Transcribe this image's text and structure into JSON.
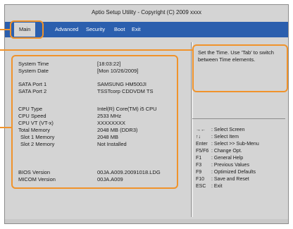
{
  "window": {
    "title": "Aptio Setup Utility - Copyright (C) 2009 xxxx"
  },
  "menu": {
    "items": [
      "Main",
      "Advanced",
      "Security",
      "Boot",
      "Exit"
    ],
    "active": "Main"
  },
  "main": {
    "rows": [
      {
        "label": "System Time",
        "value": "[18:03:22]"
      },
      {
        "label": "System Date",
        "value": "[Mon 10/26/2009]"
      },
      {
        "label": "SATA Port 1",
        "value": "SAMSUNG HM500JI"
      },
      {
        "label": "SATA Port 2",
        "value": "TSSTcorp CDDVDM TS"
      },
      {
        "label": "CPU Type",
        "value": "Intel(R) Core(TM) i5 CPU"
      },
      {
        "label": "CPU Speed",
        "value": "2533 MHz"
      },
      {
        "label": "CPU VT (VT-x)",
        "value": "XXXXXXXX"
      },
      {
        "label": "Total Memory",
        "value": "2048 MB (DDR3)"
      },
      {
        "label": " Slot 1 Memory",
        "value": "2048 MB"
      },
      {
        "label": " Slot 2 Memory",
        "value": "Not Installed"
      },
      {
        "label": "BIOS Version",
        "value": "00JA.A009.20091018.LDG"
      },
      {
        "label": "MICOM Version",
        "value": "00JA.A009"
      }
    ]
  },
  "help": {
    "text": "Set the Time. Use 'Tab' to switch between Time elements."
  },
  "keys": [
    {
      "key": "→←",
      "desc": ": Select Screen"
    },
    {
      "key": "↑↓",
      "desc": ": Select Item"
    },
    {
      "key": "Enter",
      "desc": ": Select >> Sub-Menu"
    },
    {
      "key": "F5/F6",
      "desc": ": Change Opt."
    },
    {
      "key": "F1",
      "desc": ": General Help"
    },
    {
      "key": "F3",
      "desc": ": Previous Values"
    },
    {
      "key": "F9",
      "desc": ": Optimized Defaults"
    },
    {
      "key": "F10",
      "desc": ": Save and Reset"
    },
    {
      "key": "ESC",
      "desc": ": Exit"
    }
  ],
  "colors": {
    "menubar": "#2b5fae",
    "highlight": "#f0932b",
    "panel": "#d4d4d4"
  }
}
